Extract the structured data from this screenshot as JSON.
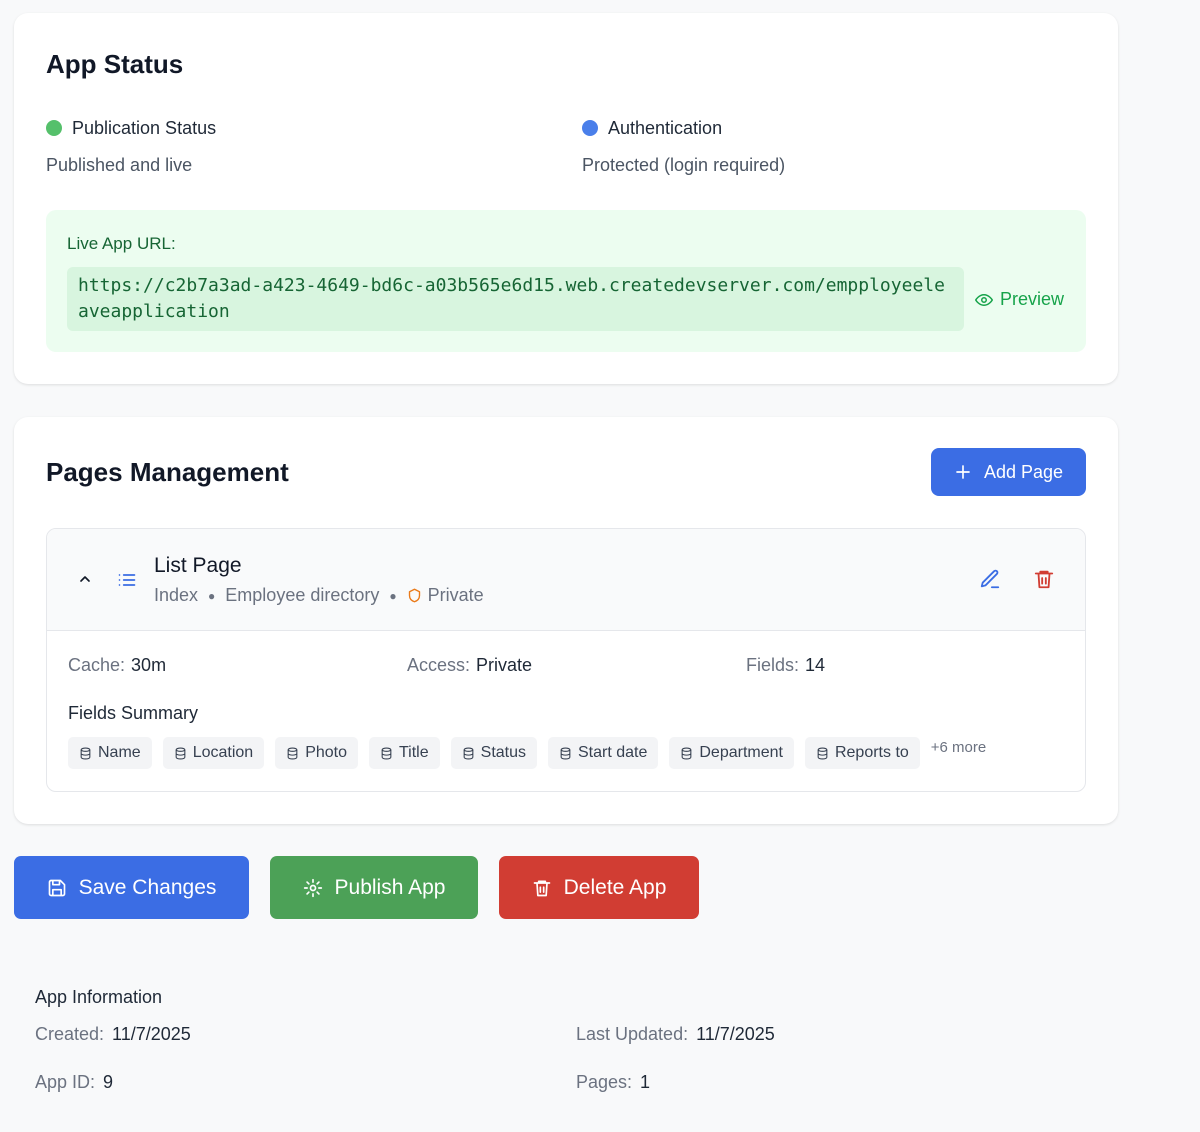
{
  "colors": {
    "publication_dot": "#55c06b",
    "auth_dot": "#4a7fea",
    "primary": "#3b6de4",
    "success": "#4ca157",
    "danger": "#d13d33"
  },
  "app_status": {
    "title": "App Status",
    "publication": {
      "label": "Publication Status",
      "value": "Published and live"
    },
    "authentication": {
      "label": "Authentication",
      "value": "Protected (login required)"
    },
    "live_url": {
      "label": "Live App URL:",
      "url": "https://c2b7a3ad-a423-4649-bd6c-a03b565e6d15.web.createdevserver.com/empployeeleaveapplication",
      "preview_label": "Preview"
    }
  },
  "pages_management": {
    "title": "Pages Management",
    "add_button": "Add Page",
    "page": {
      "name": "List Page",
      "route": "Index",
      "description": "Employee directory",
      "visibility": "Private",
      "cache_label": "Cache:",
      "cache_value": "30m",
      "access_label": "Access:",
      "access_value": "Private",
      "fields_label": "Fields:",
      "fields_value": "14",
      "fields_summary_title": "Fields Summary",
      "fields": [
        "Name",
        "Location",
        "Photo",
        "Title",
        "Status",
        "Start date",
        "Department",
        "Reports to"
      ],
      "more": "+6 more"
    }
  },
  "actions": {
    "save": "Save Changes",
    "publish": "Publish App",
    "delete": "Delete App"
  },
  "app_info": {
    "title": "App Information",
    "created_label": "Created:",
    "created_value": "11/7/2025",
    "updated_label": "Last Updated:",
    "updated_value": "11/7/2025",
    "id_label": "App ID:",
    "id_value": "9",
    "pages_label": "Pages:",
    "pages_value": "1"
  }
}
